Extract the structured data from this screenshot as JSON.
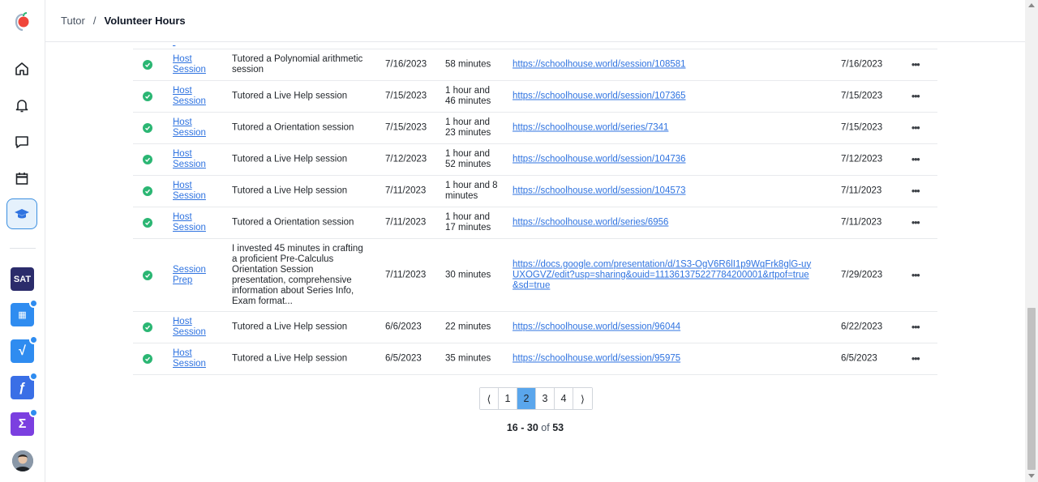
{
  "header": {
    "breadcrumb_root": "Tutor",
    "breadcrumb_sep": "/",
    "title": "Volunteer Hours"
  },
  "sidebar": {
    "items": [
      {
        "icon": "home-icon"
      },
      {
        "icon": "bell-icon"
      },
      {
        "icon": "chat-icon"
      },
      {
        "icon": "calendar-icon"
      },
      {
        "icon": "graduation-cap-icon",
        "active": true
      }
    ],
    "apps": [
      {
        "label": "SAT",
        "color": "#2b2c6b"
      },
      {
        "label": "▦",
        "color": "#2f8cf0"
      },
      {
        "label": "√",
        "color": "#2f8cf0"
      },
      {
        "label": "ƒ",
        "color": "#3a6fe6"
      },
      {
        "label": "Σ",
        "color": "#7b3fe0"
      }
    ]
  },
  "rows": [
    {
      "type": "Host Session",
      "desc": "Tutored a Polynomial arithmetic session",
      "date": "7/16/2023",
      "duration": "58 minutes",
      "url": "https://schoolhouse.world/session/108581",
      "approved": "7/16/2023"
    },
    {
      "type": "Host Session",
      "desc": "Tutored a Live Help session",
      "date": "7/15/2023",
      "duration": "1 hour and 46 minutes",
      "url": "https://schoolhouse.world/session/107365",
      "approved": "7/15/2023"
    },
    {
      "type": "Host Session",
      "desc": "Tutored a Orientation session",
      "date": "7/15/2023",
      "duration": "1 hour and 23 minutes",
      "url": "https://schoolhouse.world/series/7341",
      "approved": "7/15/2023"
    },
    {
      "type": "Host Session",
      "desc": "Tutored a Live Help session",
      "date": "7/12/2023",
      "duration": "1 hour and 52 minutes",
      "url": "https://schoolhouse.world/session/104736",
      "approved": "7/12/2023"
    },
    {
      "type": "Host Session",
      "desc": "Tutored a Live Help session",
      "date": "7/11/2023",
      "duration": "1 hour and 8 minutes",
      "url": "https://schoolhouse.world/session/104573",
      "approved": "7/11/2023"
    },
    {
      "type": "Host Session",
      "desc": "Tutored a Orientation session",
      "date": "7/11/2023",
      "duration": "1 hour and 17 minutes",
      "url": "https://schoolhouse.world/series/6956",
      "approved": "7/11/2023"
    },
    {
      "type": "Session Prep",
      "desc": "I invested 45 minutes in crafting a proficient Pre-Calculus Orientation Session presentation, comprehensive information about Series Info, Exam format...",
      "date": "7/11/2023",
      "duration": "30 minutes",
      "url": "https://docs.google.com/presentation/d/1S3-OgV6R6lI1p9WqFrk8glG-uyUXOGVZ/edit?usp=sharing&ouid=111361375227784200001&rtpof=true&sd=true",
      "approved": "7/29/2023"
    },
    {
      "type": "Host Session",
      "desc": "Tutored a Live Help session",
      "date": "6/6/2023",
      "duration": "22 minutes",
      "url": "https://schoolhouse.world/session/96044",
      "approved": "6/22/2023"
    },
    {
      "type": "Host Session",
      "desc": "Tutored a Live Help session",
      "date": "6/5/2023",
      "duration": "35 minutes",
      "url": "https://schoolhouse.world/session/95975",
      "approved": "6/5/2023"
    }
  ],
  "more_label": "•••",
  "pagination": {
    "prev": "⟨",
    "pages": [
      "1",
      "2",
      "3",
      "4"
    ],
    "current": "2",
    "next": "⟩"
  },
  "count": {
    "start": "16",
    "dash": "-",
    "end": "30",
    "of": "of",
    "total": "53"
  }
}
